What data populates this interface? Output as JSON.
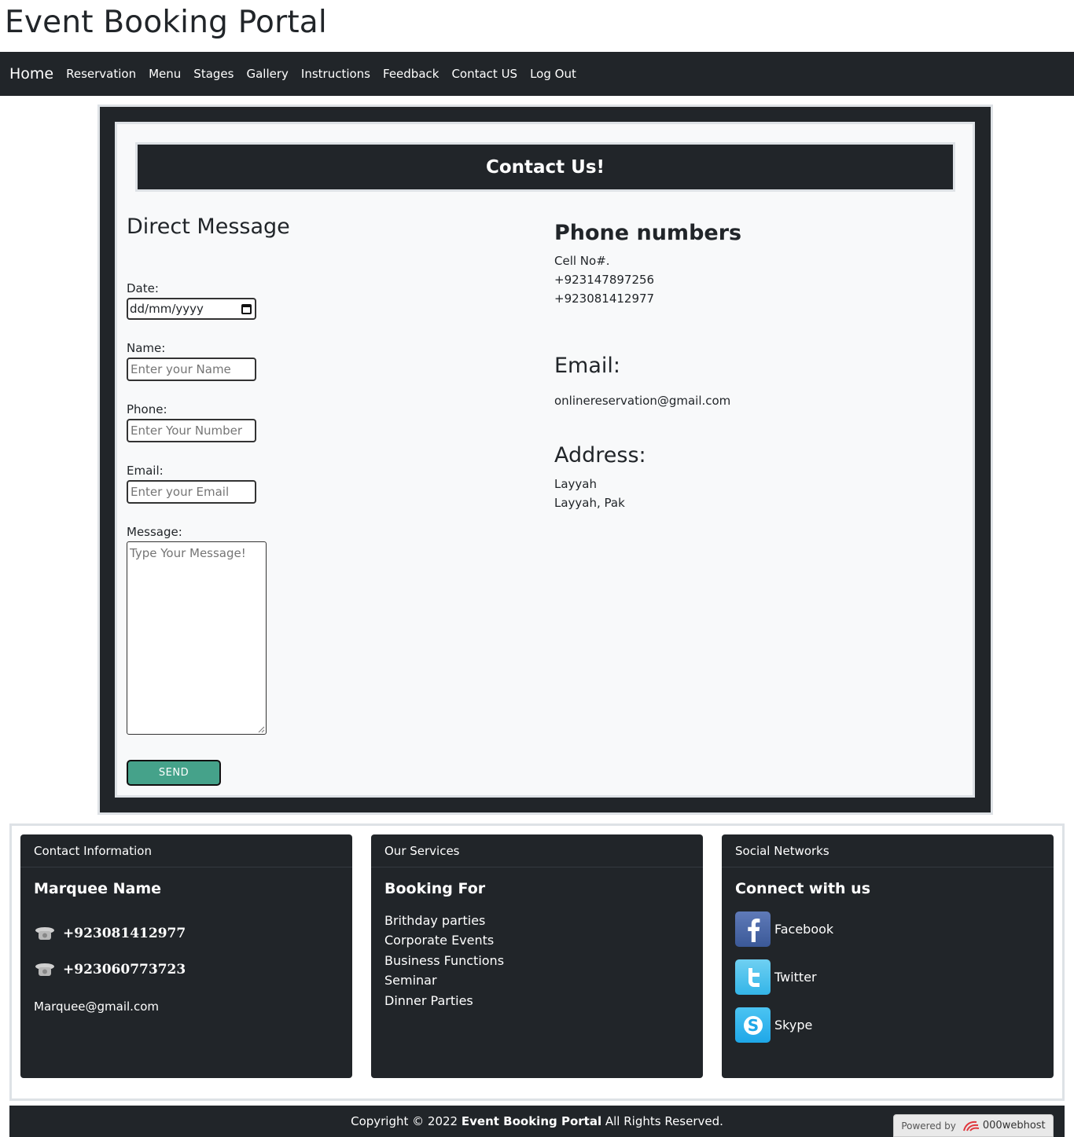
{
  "site": {
    "title": "Event Booking Portal"
  },
  "nav": {
    "brand": "Home",
    "links": [
      "Reservation",
      "Menu",
      "Stages",
      "Gallery",
      "Instructions",
      "Feedback",
      "Contact US",
      "Log Out"
    ]
  },
  "contact": {
    "header": "Contact Us!",
    "form": {
      "title": "Direct Message",
      "date_label": "Date:",
      "date_value": "dd/mm/yyyy",
      "name_label": "Name:",
      "name_placeholder": "Enter your Name",
      "phone_label": "Phone:",
      "phone_placeholder": "Enter Your Number",
      "email_label": "Email:",
      "email_placeholder": "Enter your Email",
      "message_label": "Message:",
      "message_placeholder": "Type Your Message!",
      "send_label": "SEND"
    },
    "info": {
      "phone_title": "Phone numbers",
      "cell_label": "Cell No#.",
      "phones": [
        "+923147897256",
        "+923081412977"
      ],
      "email_title": "Email:",
      "email": "onlinereservation@gmail.com",
      "address_title": "Address:",
      "address_lines": [
        "Layyah",
        "Layyah, Pak"
      ]
    }
  },
  "footer": {
    "contact_card": {
      "header": "Contact Information",
      "title": "Marquee Name",
      "phones": [
        "+923081412977",
        "+923060773723"
      ],
      "email": "Marquee@gmail.com"
    },
    "services_card": {
      "header": "Our Services",
      "title": "Booking For",
      "items": [
        "Brithday parties",
        "Corporate Events",
        "Business Functions",
        "Seminar",
        "Dinner Parties"
      ]
    },
    "social_card": {
      "header": "Social Networks",
      "title": "Connect with us",
      "networks": [
        {
          "name": "Facebook",
          "icon": "facebook-icon",
          "color": "#3b5998"
        },
        {
          "name": "Twitter",
          "icon": "twitter-icon",
          "color": "#33b5e8"
        },
        {
          "name": "Skype",
          "icon": "skype-icon",
          "color": "#1ea7e8"
        }
      ]
    },
    "copyright_prefix": "Copyright © 2022",
    "copyright_brand": "Event Booking Portal",
    "copyright_suffix": "All Rights Reserved.",
    "powered_by": "Powered by",
    "host_brand": "000webhost"
  },
  "colors": {
    "dark": "#212529",
    "panel": "#f8f9fa",
    "border": "#dee2e6",
    "send": "#45a28a"
  }
}
